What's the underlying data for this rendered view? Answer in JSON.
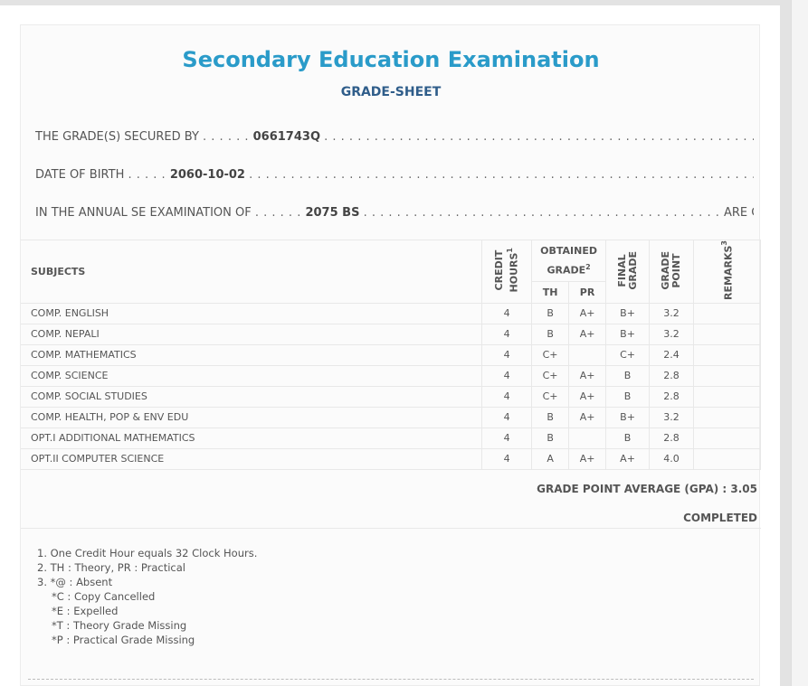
{
  "header": {
    "title": "Secondary Education Examination",
    "subtitle": "GRADE-SHEET"
  },
  "info": {
    "secured_by_label": "THE GRADE(S) SECURED BY",
    "secured_by_value": "0661743Q",
    "dob_label": "DATE OF BIRTH",
    "dob_value": "2060-10-02",
    "exam_label": "IN THE ANNUAL SE EXAMINATION OF",
    "exam_value": "2075 BS",
    "exam_suffix": "ARE GIVEN BELOW"
  },
  "table": {
    "headers": {
      "subjects": "SUBJECTS",
      "credit_line1": "CREDIT",
      "credit_line2": "HOURS",
      "credit_sup": "1",
      "obtained_line1": "OBTAINED",
      "obtained_line2": "GRADE",
      "obtained_sup": "2",
      "th": "TH",
      "pr": "PR",
      "final_line1": "FINAL",
      "final_line2": "GRADE",
      "gp_line1": "GRADE",
      "gp_line2": "POINT",
      "remarks": "REMARKS",
      "remarks_sup": "3"
    },
    "rows": [
      {
        "subject": "COMP. ENGLISH",
        "credit": "4",
        "th": "B",
        "pr": "A+",
        "final": "B+",
        "gp": "3.2",
        "remarks": ""
      },
      {
        "subject": "COMP. NEPALI",
        "credit": "4",
        "th": "B",
        "pr": "A+",
        "final": "B+",
        "gp": "3.2",
        "remarks": ""
      },
      {
        "subject": "COMP. MATHEMATICS",
        "credit": "4",
        "th": "C+",
        "pr": "",
        "final": "C+",
        "gp": "2.4",
        "remarks": ""
      },
      {
        "subject": "COMP. SCIENCE",
        "credit": "4",
        "th": "C+",
        "pr": "A+",
        "final": "B",
        "gp": "2.8",
        "remarks": ""
      },
      {
        "subject": "COMP. SOCIAL STUDIES",
        "credit": "4",
        "th": "C+",
        "pr": "A+",
        "final": "B",
        "gp": "2.8",
        "remarks": ""
      },
      {
        "subject": "COMP. HEALTH, POP & ENV EDU",
        "credit": "4",
        "th": "B",
        "pr": "A+",
        "final": "B+",
        "gp": "3.2",
        "remarks": ""
      },
      {
        "subject": "OPT.I ADDITIONAL MATHEMATICS",
        "credit": "4",
        "th": "B",
        "pr": "",
        "final": "B",
        "gp": "2.8",
        "remarks": ""
      },
      {
        "subject": "OPT.II COMPUTER SCIENCE",
        "credit": "4",
        "th": "A",
        "pr": "A+",
        "final": "A+",
        "gp": "4.0",
        "remarks": ""
      }
    ]
  },
  "summary": {
    "gpa_label": "GRADE POINT AVERAGE (GPA) : 3.05",
    "status": "COMPLETED"
  },
  "notes": [
    "1. One Credit Hour equals 32 Clock Hours.",
    "2. TH : Theory, PR : Practical",
    "3. *@ : Absent",
    "*C : Copy Cancelled",
    "*E : Expelled",
    "*T : Theory Grade Missing",
    "*P : Practical Grade Missing"
  ]
}
